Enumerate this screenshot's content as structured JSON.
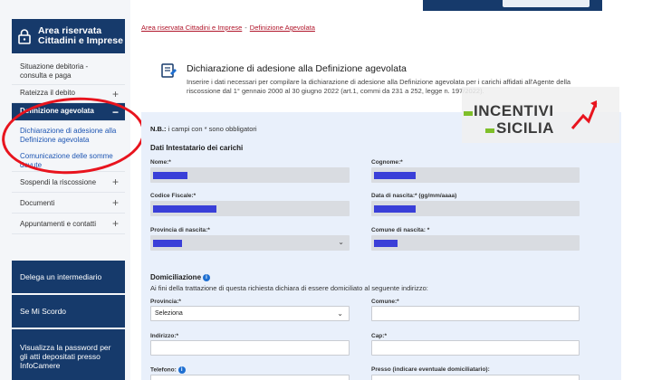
{
  "header": {
    "area_title_line1": "Area riservata",
    "area_title_line2": "Cittadini e Imprese"
  },
  "sidebar": {
    "items": [
      {
        "label": "Situazione debitoria - consulta e paga"
      },
      {
        "label": "Rateizza il debito"
      },
      {
        "label": "Definizione agevolata"
      },
      {
        "label": "Comunicazione delle somme dovute"
      },
      {
        "label": "Sospendi la riscossione"
      },
      {
        "label": "Documenti"
      },
      {
        "label": "Appuntamenti e contatti"
      }
    ],
    "active_sub": "Dichiarazione di adesione alla Definizione agevolata",
    "boxes": [
      {
        "label": "Delega un intermediario"
      },
      {
        "label": "Se Mi Scordo"
      },
      {
        "label": "Visualizza la password per gli atti depositati presso InfoCamere"
      }
    ]
  },
  "breadcrumb": {
    "first": "Area riservata Cittadini e Imprese",
    "separator": "-",
    "second": "Definizione Agevolata"
  },
  "page": {
    "title": "Dichiarazione di adesione alla Definizione agevolata",
    "description": "Inserire i dati necessari per compilare la dichiarazione di adesione alla Definizione agevolata per i carichi affidati all'Agente della riscossione dal 1° gennaio 2000 al 30 giugno 2022 (art.1, commi da 231 a 252, legge n. 197/2022)."
  },
  "form": {
    "nb_bold": "N.B.:",
    "nb_text": " i campi con * sono obbligatori",
    "section_intestatario": "Dati Intestatario dei carichi",
    "labels": {
      "nome": "Nome:*",
      "cognome": "Cognome:*",
      "codice_fiscale": "Codice Fiscale:*",
      "data_nascita": "Data di nascita:* (gg/mm/aaaa)",
      "provincia_nascita": "Provincia di nascita:*",
      "comune_nascita": "Comune di nascita: *",
      "provincia": "Provincia:*",
      "comune": "Comune:*",
      "indirizzo": "Indirizzo:*",
      "cap": "Cap:*",
      "telefono": "Telefono:",
      "presso": "Presso (indicare eventuale domiciliatario):"
    },
    "section_domiciliazione": "Domiciliazione",
    "domiciliazione_desc": "Ai fini della trattazione di questa richiesta dichiara di essere domiciliato al seguente indirizzo:",
    "provincia_value": "Seleziona"
  },
  "watermark": {
    "line1": "INCENTIVI",
    "line2": "SICILIA"
  },
  "colors": {
    "brand_navy": "#163a6b",
    "accent_red": "#b0152a",
    "annotation_red": "#e8141e",
    "redaction_blue": "#3a3fd8",
    "watermark_green": "#7fbf2a"
  }
}
